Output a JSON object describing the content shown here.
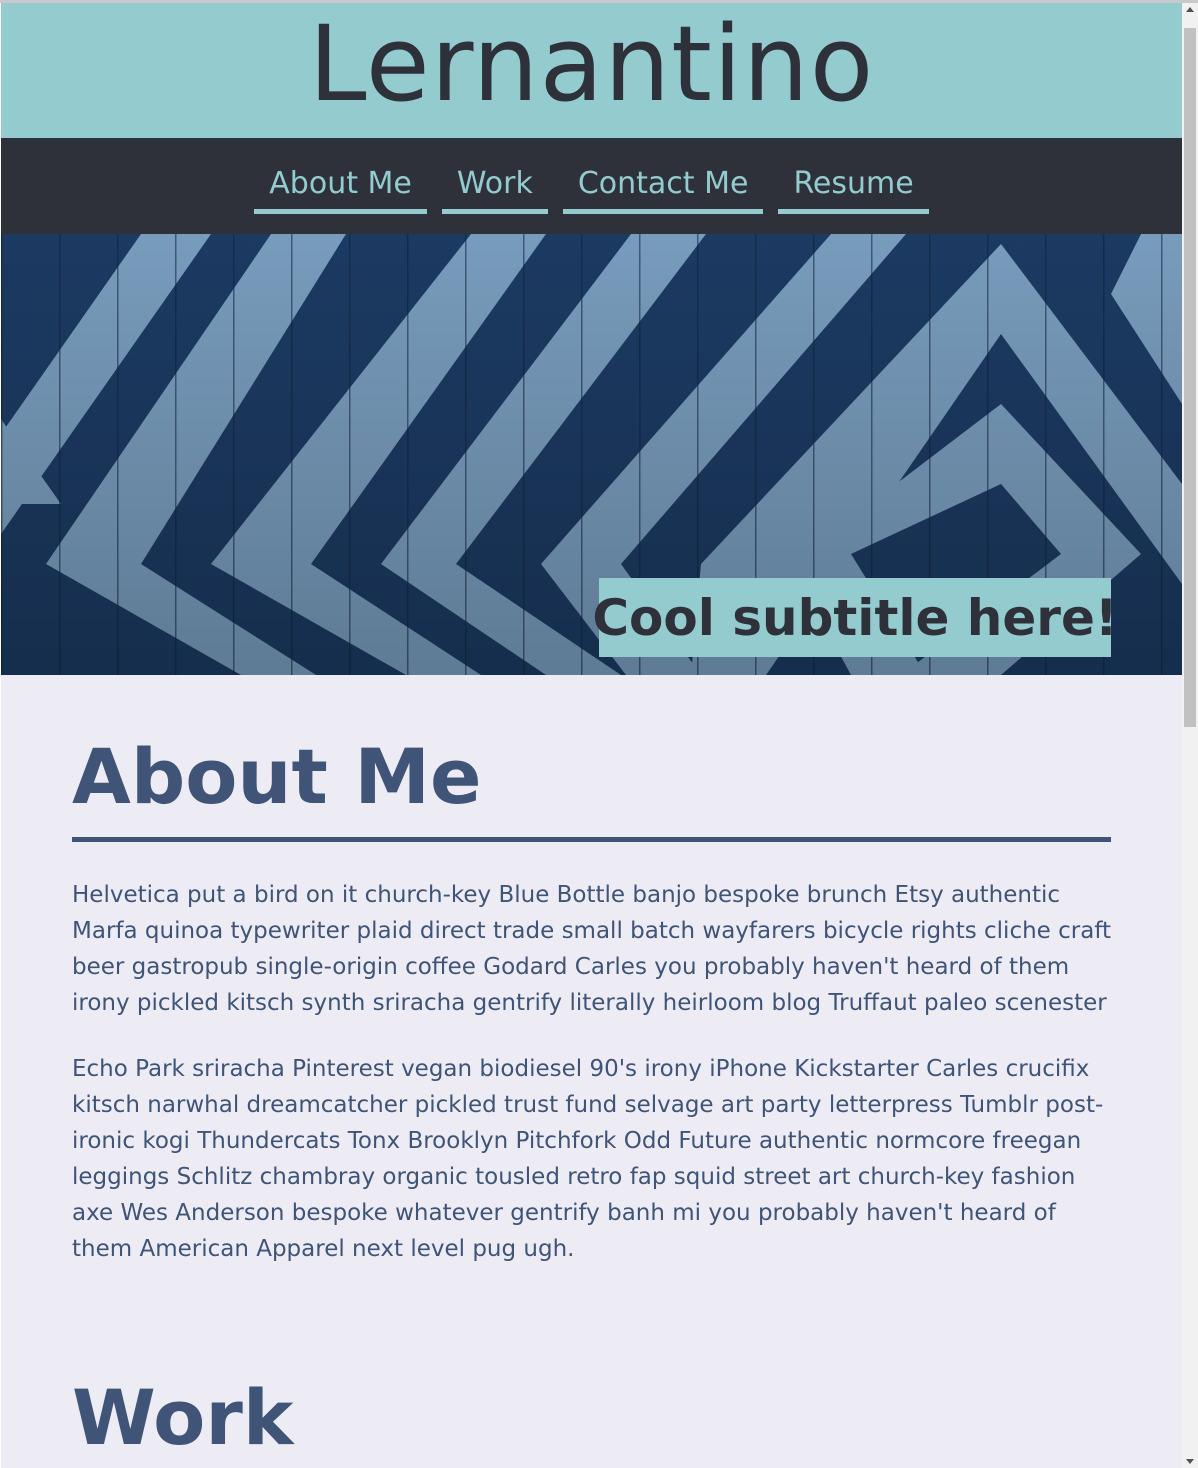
{
  "header": {
    "site_title": "Lernantino"
  },
  "nav": {
    "items": [
      {
        "label": "About Me"
      },
      {
        "label": "Work"
      },
      {
        "label": "Contact Me"
      },
      {
        "label": "Resume"
      }
    ]
  },
  "hero": {
    "subtitle": "Cool subtitle here!"
  },
  "about": {
    "heading": "About Me",
    "paragraphs": [
      "Helvetica put a bird on it church-key Blue Bottle banjo bespoke brunch Etsy authentic Marfa quinoa typewriter plaid direct trade small batch wayfarers bicycle rights cliche craft beer gastropub single-origin coffee Godard Carles you probably haven't heard of them irony pickled kitsch synth sriracha gentrify literally heirloom blog Truffaut paleo scenester",
      "Echo Park sriracha Pinterest vegan biodiesel 90's irony iPhone Kickstarter Carles crucifix kitsch narwhal dreamcatcher pickled trust fund selvage art party letterpress Tumblr post-ironic kogi Thundercats Tonx Brooklyn Pitchfork Odd Future authentic normcore freegan leggings Schlitz chambray organic tousled retro fap squid street art church-key fashion axe Wes Anderson bespoke whatever gentrify banh mi you probably haven't heard of them American Apparel next level pug ugh."
    ]
  },
  "work": {
    "heading": "Work"
  },
  "colors": {
    "header_bg": "#93cbce",
    "nav_bg": "#2e313a",
    "accent_teal": "#93cbce",
    "heading_blue": "#3f5476",
    "page_bg": "#edecf5",
    "hero_dark": "#1d3d67",
    "hero_light": "#7ea4c6"
  },
  "icons": {
    "scroll_up": "scroll-up-arrow-icon",
    "scroll_down": "scroll-down-arrow-icon"
  }
}
